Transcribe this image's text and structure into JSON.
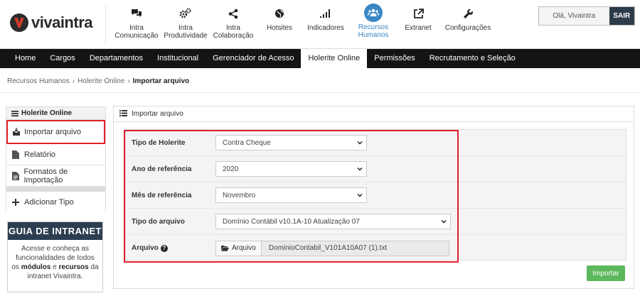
{
  "brand": {
    "name": "vivaintra"
  },
  "apps": [
    {
      "line1": "Intra",
      "line2": "Comunicação",
      "icon": "chat-icon"
    },
    {
      "line1": "Intra",
      "line2": "Produtividade",
      "icon": "gears-icon"
    },
    {
      "line1": "Intra",
      "line2": "Colaboração",
      "icon": "share-icon"
    },
    {
      "line1": "Hotsites",
      "line2": "",
      "icon": "globe-icon"
    },
    {
      "line1": "Indicadores",
      "line2": "",
      "icon": "bar-chart-icon"
    },
    {
      "line1": "Recursos",
      "line2": "Humanos",
      "icon": "people-icon"
    },
    {
      "line1": "Extranet",
      "line2": "",
      "icon": "external-link-icon"
    },
    {
      "line1": "Configurações",
      "line2": "",
      "icon": "wrench-icon"
    }
  ],
  "user": {
    "greeting": "Olá, Vivaintra",
    "logout": "SAIR"
  },
  "nav": [
    "Home",
    "Cargos",
    "Departamentos",
    "Institucional",
    "Gerenciador de Acesso",
    "Holerite Online",
    "Permissões",
    "Recrutamento e Seleção"
  ],
  "breadcrumb": {
    "root": "Recursos Humanos",
    "section": "Holerite Online",
    "current": "Importar arquivo",
    "separator": "›"
  },
  "sidebar": {
    "title": "Holerite Online",
    "items": [
      "Importar arquivo",
      "Relatório",
      "Formatos de Importação"
    ],
    "add": "Adicionar Tipo"
  },
  "banner": {
    "title": "GUIA DE INTRANET",
    "text1": "Acesse e conheça as funcionalidades de todos os",
    "bold1": "módulos",
    "text2": "e",
    "bold2": "recursos",
    "text3": "da intranet Vivaintra."
  },
  "panel": {
    "title": "Importar arquivo"
  },
  "form": {
    "tipo_holerite": {
      "label": "Tipo de Holerite",
      "value": "Contra Cheque"
    },
    "ano": {
      "label": "Ano de referência",
      "value": "2020"
    },
    "mes": {
      "label": "Mês de referência",
      "value": "Novembro"
    },
    "tipo_arquivo": {
      "label": "Tipo do arquivo",
      "value": "Domínio Contábil v10.1A-10 Atualização 07"
    },
    "arquivo": {
      "label": "Arquivo",
      "button": "Arquivo",
      "filename": "DominioContabil_V101A10A07 (1).txt"
    }
  },
  "submit": {
    "label": "Importar"
  },
  "colors": {
    "accent": "#3a87c4",
    "nav": "#141414",
    "highlight": "#e0202b",
    "success": "#5cb85c",
    "logout": "#2e3b4a"
  }
}
